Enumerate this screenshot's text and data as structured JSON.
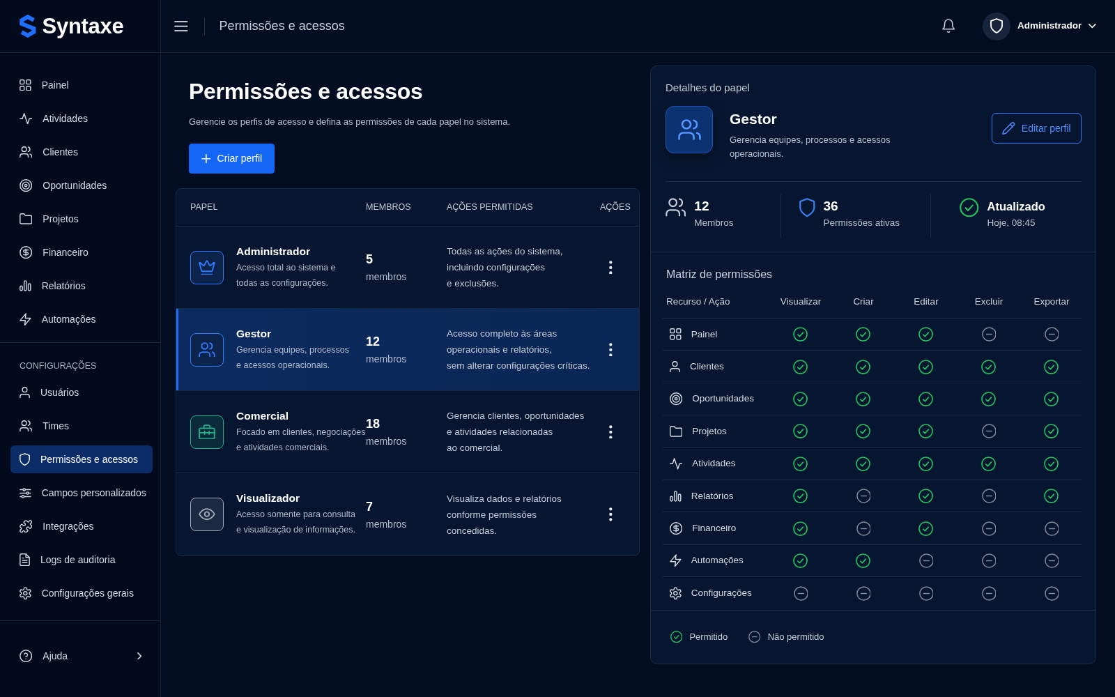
{
  "brand": {
    "name": "Syntaxe"
  },
  "sidebar": {
    "main_items": [
      {
        "label": "Painel",
        "selected": false
      },
      {
        "label": "Atividades",
        "selected": false
      },
      {
        "label": "Clientes",
        "selected": false
      },
      {
        "label": "Oportunidades",
        "selected": false
      },
      {
        "label": "Projetos",
        "selected": false
      },
      {
        "label": "Financeiro",
        "selected": false
      },
      {
        "label": "Relatórios",
        "selected": false
      },
      {
        "label": "Automações",
        "selected": false
      }
    ],
    "section_title": "CONFIGURAÇÕES",
    "config_items": [
      {
        "label": "Usuários",
        "selected": false
      },
      {
        "label": "Times",
        "selected": false
      },
      {
        "label": "Permissões e acessos",
        "selected": true
      },
      {
        "label": "Campos personalizados",
        "selected": false
      },
      {
        "label": "Integrações",
        "selected": false
      },
      {
        "label": "Logs de auditoria",
        "selected": false
      },
      {
        "label": "Configurações gerais",
        "selected": false
      }
    ],
    "footer_item": {
      "label": "Ajuda"
    }
  },
  "header": {
    "title": "Permissões e acessos",
    "user_name": "Administrador"
  },
  "page": {
    "title": "Permissões e acessos",
    "subtitle": "Gerencie os perfis de acesso e defina as permissões de cada papel no sistema.",
    "create_button": "Criar perfil"
  },
  "roles_table": {
    "columns": [
      "PAPEL",
      "MEMBROS",
      "AÇÕES PERMITIDAS",
      "AÇÕES"
    ],
    "rows": [
      {
        "name": "Administrador",
        "description": "Acesso total ao sistema e\ntodas as configurações.",
        "members": "5",
        "members_label": "membros",
        "allowed_actions": "Todas as ações do sistema,\nincluindo configurações\ne exclusões.",
        "color": "#2f7bff",
        "selected": false
      },
      {
        "name": "Gestor",
        "description": "Gerencia equipes, processos\ne acessos operacionais.",
        "members": "12",
        "members_label": "membros",
        "allowed_actions": "Acesso completo às áreas\noperacionais e relatórios,\nsem alterar configurações críticas.",
        "color": "#2f7bff",
        "selected": true
      },
      {
        "name": "Comercial",
        "description": "Focado em clientes, negociações\ne atividades comerciais.",
        "members": "18",
        "members_label": "membros",
        "allowed_actions": "Gerencia clientes, oportunidades\ne atividades relacionadas\nao comercial.",
        "color": "#22b08a",
        "selected": false
      },
      {
        "name": "Visualizador",
        "description": "Acesso somente para consulta\ne visualização de informações.",
        "members": "7",
        "members_label": "membros",
        "allowed_actions": "Visualiza dados e relatórios\nconforme permissões\nconcedidas.",
        "color": "#a3acbb",
        "selected": false
      }
    ]
  },
  "details": {
    "title": "Detalhes do papel",
    "role_name": "Gestor",
    "role_description": "Gerencia equipes, processos e acessos operacionais.",
    "edit_button": "Editar perfil",
    "stats": [
      {
        "value": "12",
        "label": "Membros"
      },
      {
        "value": "36",
        "label": "Permissões ativas"
      },
      {
        "value": "Atualizado",
        "label": "Hoje, 08:45"
      }
    ]
  },
  "matrix": {
    "title": "Matriz de permissões",
    "columns": [
      "Recurso / Ação",
      "Visualizar",
      "Criar",
      "Editar",
      "Excluir",
      "Exportar"
    ],
    "rows": [
      {
        "resource": "Painel",
        "permissions": [
          {
            "allowed": true
          },
          {
            "allowed": true
          },
          {
            "allowed": true
          },
          {
            "allowed": false
          },
          {
            "allowed": false
          }
        ]
      },
      {
        "resource": "Clientes",
        "permissions": [
          {
            "allowed": true
          },
          {
            "allowed": true
          },
          {
            "allowed": true
          },
          {
            "allowed": true
          },
          {
            "allowed": true
          }
        ]
      },
      {
        "resource": "Oportunidades",
        "permissions": [
          {
            "allowed": true
          },
          {
            "allowed": true
          },
          {
            "allowed": true
          },
          {
            "allowed": true
          },
          {
            "allowed": true
          }
        ]
      },
      {
        "resource": "Projetos",
        "permissions": [
          {
            "allowed": true
          },
          {
            "allowed": true
          },
          {
            "allowed": true
          },
          {
            "allowed": false
          },
          {
            "allowed": true
          }
        ]
      },
      {
        "resource": "Atividades",
        "permissions": [
          {
            "allowed": true
          },
          {
            "allowed": true
          },
          {
            "allowed": true
          },
          {
            "allowed": true
          },
          {
            "allowed": true
          }
        ]
      },
      {
        "resource": "Relatórios",
        "permissions": [
          {
            "allowed": true
          },
          {
            "allowed": false
          },
          {
            "allowed": true
          },
          {
            "allowed": false
          },
          {
            "allowed": true
          }
        ]
      },
      {
        "resource": "Financeiro",
        "permissions": [
          {
            "allowed": true
          },
          {
            "allowed": false
          },
          {
            "allowed": true
          },
          {
            "allowed": false
          },
          {
            "allowed": false
          }
        ]
      },
      {
        "resource": "Automações",
        "permissions": [
          {
            "allowed": true
          },
          {
            "allowed": true
          },
          {
            "allowed": false
          },
          {
            "allowed": false
          },
          {
            "allowed": false
          }
        ]
      },
      {
        "resource": "Configurações",
        "permissions": [
          {
            "allowed": false
          },
          {
            "allowed": false
          },
          {
            "allowed": false
          },
          {
            "allowed": false
          },
          {
            "allowed": false
          }
        ]
      }
    ]
  },
  "legend": [
    {
      "label": "Permitido",
      "allowed": true
    },
    {
      "label": "Não permitido",
      "allowed": false
    }
  ]
}
